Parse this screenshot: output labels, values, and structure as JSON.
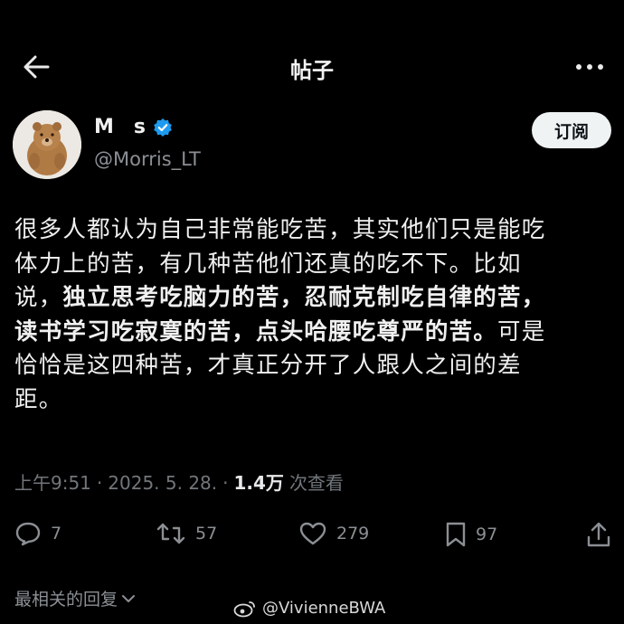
{
  "header": {
    "title": "帖子",
    "back_icon": "arrow-left-icon",
    "more_icon": "more-horizontal-icon"
  },
  "author": {
    "display_name": "M     s",
    "handle": "@Morris_LT",
    "verified_color": "#1d9bf0",
    "subscribe_label": "订阅"
  },
  "post": {
    "lines": [
      "很多人都认为自己非常能吃苦，其实他们只是能吃",
      "体力上的苦，有几种苦他们还真的吃不下。比如",
      "说，",
      "独立思考吃脑力的苦，忍耐克制吃自律的苦，",
      "读书学习吃寂寞的苦，点头哈腰吃尊严的苦。",
      "可是",
      "恰恰是这四种苦，才真正分开了人跟人之间的差",
      "距。"
    ]
  },
  "meta": {
    "time": "上午9:51",
    "sep1": "·",
    "date": "2025. 5. 28.",
    "sep2": "·",
    "views": "1.4万",
    "views_label": "次查看"
  },
  "actions": {
    "reply_count": "7",
    "repost_count": "57",
    "like_count": "279",
    "bookmark_count": "97"
  },
  "replies": {
    "sort_label": "最相关的回复"
  },
  "watermark": {
    "text": "@VivienneBWA"
  }
}
